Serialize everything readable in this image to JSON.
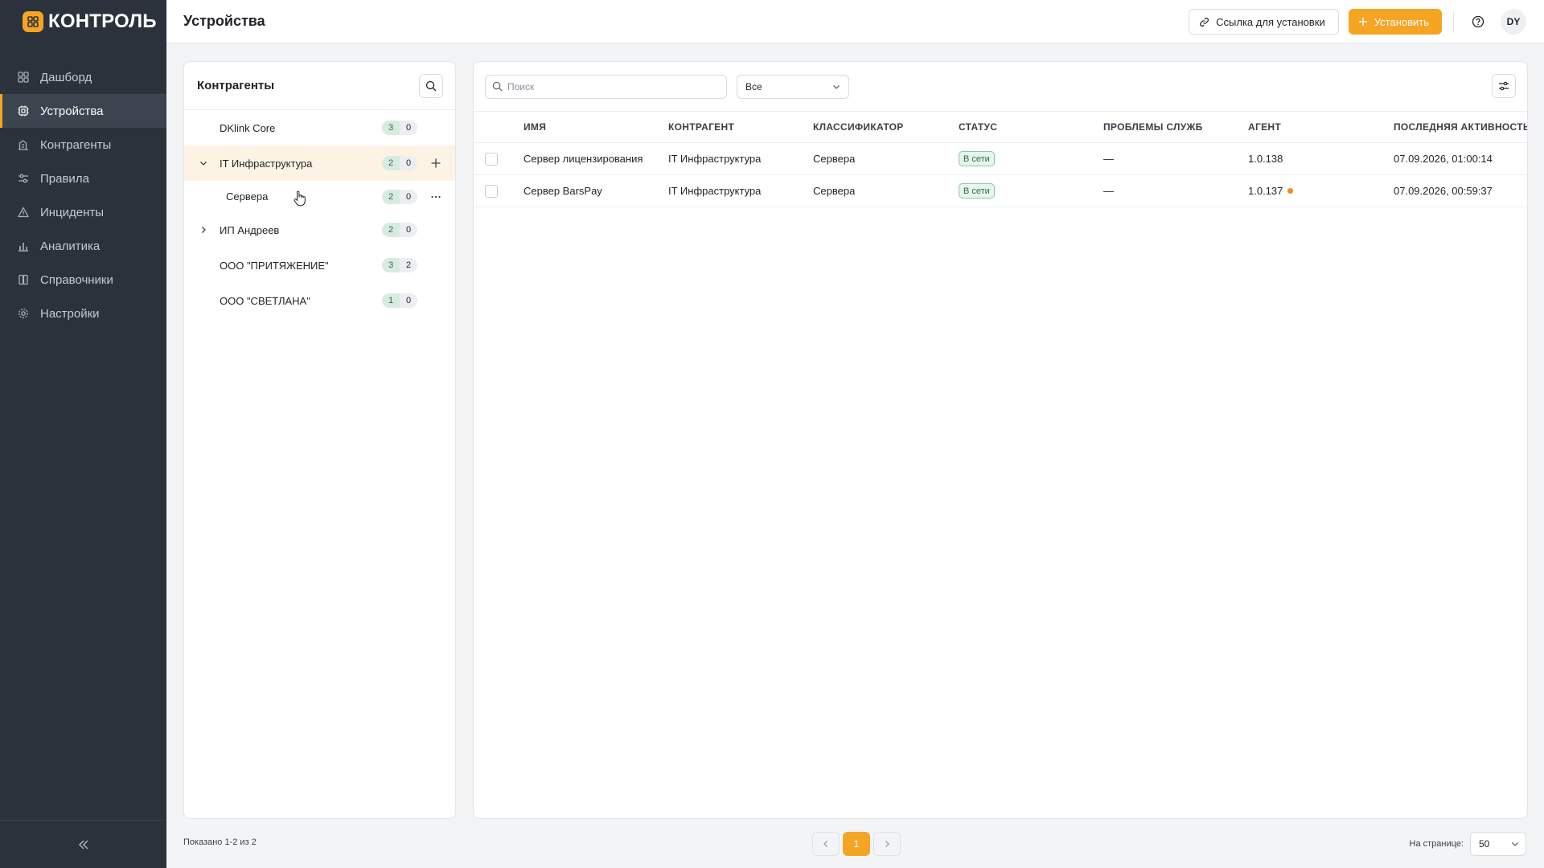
{
  "app": {
    "logo_text": "КОНТРОЛЬ",
    "accent": "#f5a524"
  },
  "sidebar": {
    "items": [
      {
        "label": "Дашборд",
        "icon": "grid-icon"
      },
      {
        "label": "Устройства",
        "icon": "device-icon",
        "active": true
      },
      {
        "label": "Контрагенты",
        "icon": "building-icon"
      },
      {
        "label": "Правила",
        "icon": "sliders-icon"
      },
      {
        "label": "Инциденты",
        "icon": "warning-icon"
      },
      {
        "label": "Аналитика",
        "icon": "bar-chart-icon"
      },
      {
        "label": "Справочники",
        "icon": "book-icon"
      },
      {
        "label": "Настройки",
        "icon": "gear-icon"
      }
    ],
    "collapse_icon": "double-chevron-left-icon"
  },
  "header": {
    "title": "Устройства",
    "install_link_label": "Ссылка для установки",
    "install_label": "Установить",
    "avatar_initials": "DY"
  },
  "counterparties": {
    "title": "Контрагенты",
    "tree": [
      {
        "label": "DKlink Core",
        "online": "3",
        "offline": "0",
        "expandable": false
      },
      {
        "label": "IT Инфраструктура",
        "online": "2",
        "offline": "0",
        "expanded": true,
        "selected": true
      },
      {
        "label": "Сервера",
        "online": "2",
        "offline": "0",
        "child": true
      },
      {
        "label": "ИП Андреев",
        "online": "2",
        "offline": "0",
        "expandable": true
      },
      {
        "label": "ООО \"ПРИТЯЖЕНИЕ\"",
        "online": "3",
        "offline": "2"
      },
      {
        "label": "ООО \"СВЕТЛАНА\"",
        "online": "1",
        "offline": "0"
      }
    ]
  },
  "devices": {
    "search_placeholder": "Поиск",
    "filter_value": "Все",
    "columns": [
      "ИМЯ",
      "КОНТРАГЕНТ",
      "КЛАССИФИКАТОР",
      "СТАТУС",
      "ПРОБЛЕМЫ СЛУЖБ",
      "АГЕНТ",
      "ПОСЛЕДНЯЯ АКТИВНОСТЬ"
    ],
    "rows": [
      {
        "name": "Сервер лицензирования",
        "counterparty": "IT Инфраструктура",
        "classifier": "Сервера",
        "status": "В сети",
        "problems": "—",
        "agent": "1.0.138",
        "agent_update": false,
        "last_activity": "07.09.2026, 01:00:14"
      },
      {
        "name": "Сервер BarsPay",
        "counterparty": "IT Инфраструктура",
        "classifier": "Сервера",
        "status": "В сети",
        "problems": "—",
        "agent": "1.0.137",
        "agent_update": true,
        "last_activity": "07.09.2026, 00:59:37"
      }
    ]
  },
  "footer": {
    "shown": "Показано 1-2 из 2",
    "current_page": "1",
    "per_page_label": "На странице:",
    "per_page_value": "50"
  }
}
